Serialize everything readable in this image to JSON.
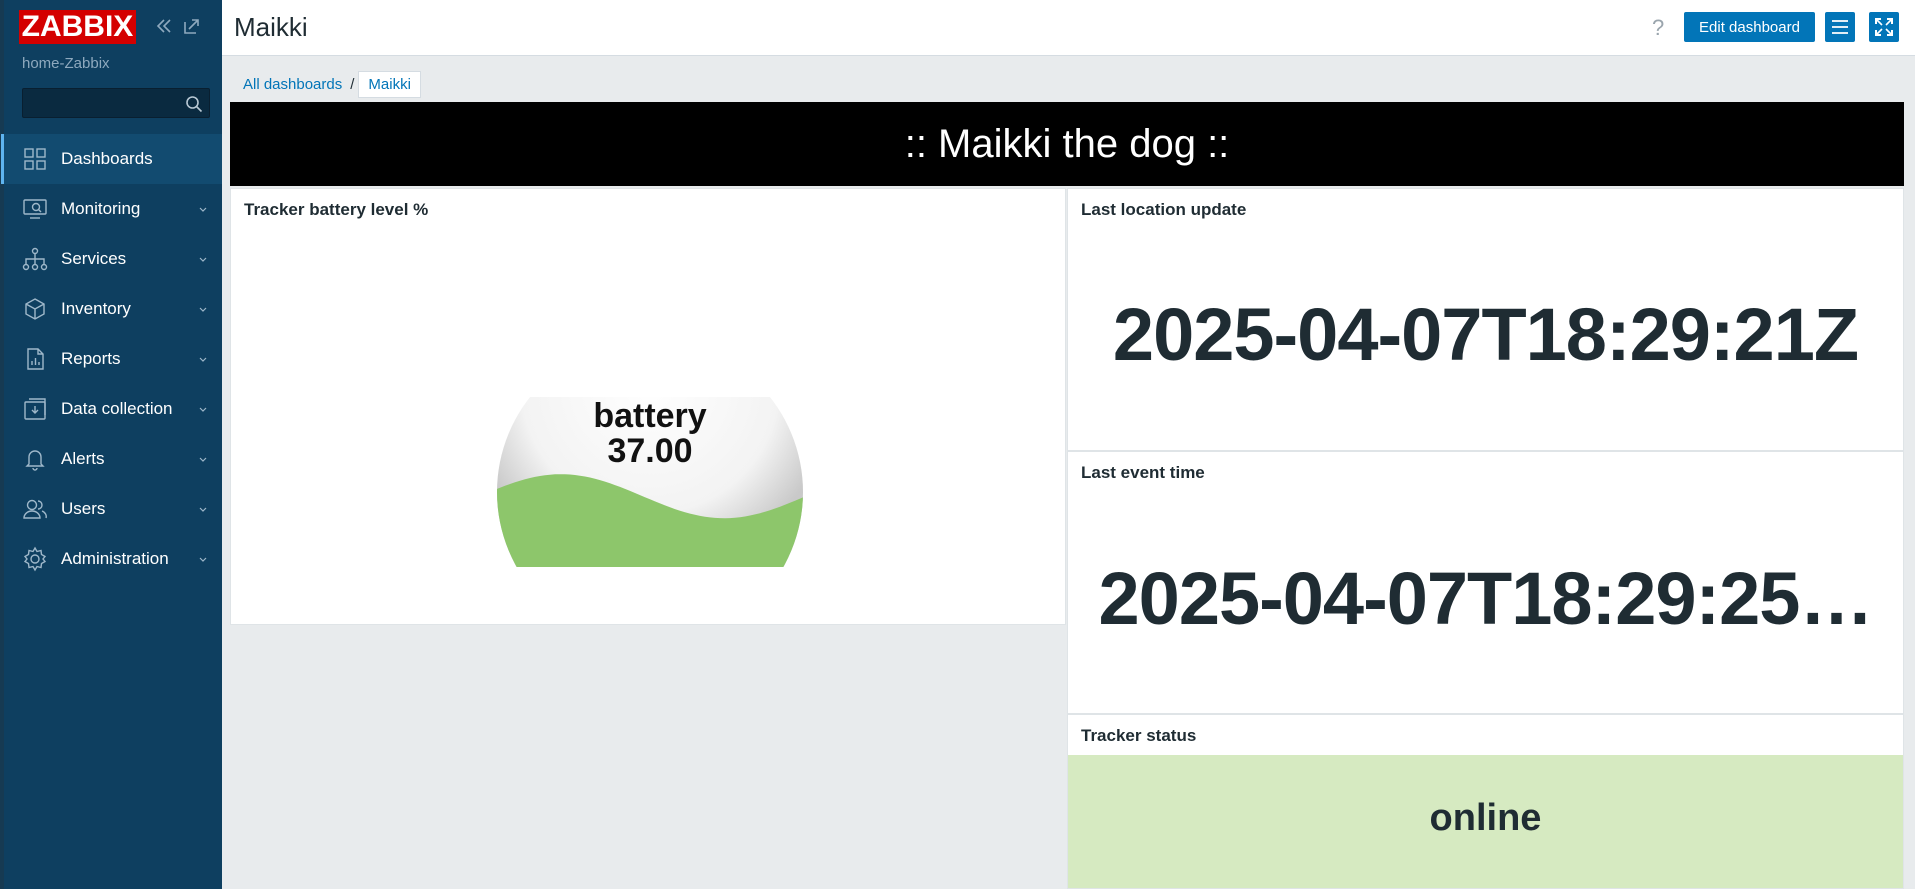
{
  "app": {
    "logo": "ZABBIX",
    "hostname": "home-Zabbix"
  },
  "search": {
    "placeholder": "",
    "value": ""
  },
  "sidebar": {
    "items": [
      {
        "label": "Dashboards",
        "icon": "dashboards-icon",
        "active": true
      },
      {
        "label": "Monitoring",
        "icon": "monitoring-icon"
      },
      {
        "label": "Services",
        "icon": "services-icon"
      },
      {
        "label": "Inventory",
        "icon": "inventory-icon"
      },
      {
        "label": "Reports",
        "icon": "reports-icon"
      },
      {
        "label": "Data collection",
        "icon": "data-collection-icon"
      },
      {
        "label": "Alerts",
        "icon": "alerts-icon"
      },
      {
        "label": "Users",
        "icon": "users-icon"
      },
      {
        "label": "Administration",
        "icon": "administration-icon"
      }
    ]
  },
  "header": {
    "title": "Maikki",
    "help": "?",
    "edit_label": "Edit dashboard"
  },
  "breadcrumb": {
    "all": "All dashboards",
    "sep": "/",
    "current": "Maikki"
  },
  "banner": {
    "text": ":: Maikki the dog ::"
  },
  "widgets": {
    "battery": {
      "title": "Tracker battery level %",
      "label": "battery",
      "value": "37.00",
      "level": 0.37,
      "color": "#8dc66b"
    },
    "location": {
      "title": "Last location update",
      "value": "2025-04-07T18:29:21Z"
    },
    "event": {
      "title": "Last event time",
      "value": "2025-04-07T18:29:25…"
    },
    "status": {
      "title": "Tracker status",
      "value": "online",
      "color": "#d6eac1"
    }
  },
  "colors": {
    "sidebar": "#0e3f60",
    "accent": "#0275b8",
    "logo": "#d40000"
  }
}
